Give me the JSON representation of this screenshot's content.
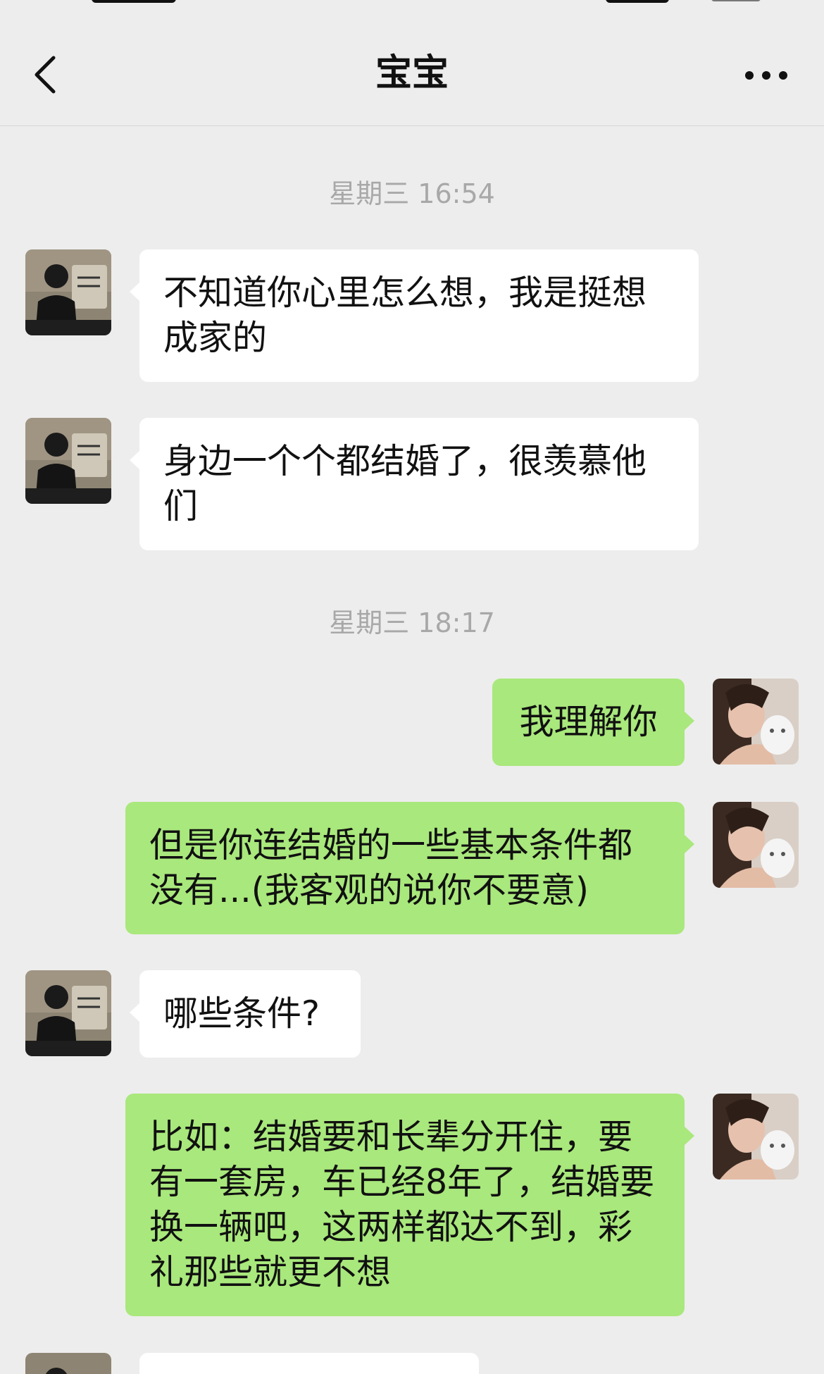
{
  "nav": {
    "title": "宝宝",
    "back_icon": "chevron-left-icon",
    "more_icon": "ellipsis-icon"
  },
  "colors": {
    "background": "#ededed",
    "incoming_bubble": "#ffffff",
    "outgoing_bubble": "#a9e87c",
    "timestamp_text": "#a8a8a8"
  },
  "messages": [
    {
      "type": "timestamp",
      "text": "星期三 16:54"
    },
    {
      "type": "message",
      "from": "other",
      "text": "不知道你心里怎么想，我是挺想成家的"
    },
    {
      "type": "message",
      "from": "other",
      "text": "身边一个个都结婚了，很羡慕他们"
    },
    {
      "type": "timestamp",
      "text": "星期三 18:17"
    },
    {
      "type": "message",
      "from": "me",
      "text": "我理解你"
    },
    {
      "type": "message",
      "from": "me",
      "text": "但是你连结婚的一些基本条件都没有...(我客观的说你不要意)"
    },
    {
      "type": "message",
      "from": "other",
      "text": "哪些条件?"
    },
    {
      "type": "message",
      "from": "me",
      "text": "比如：结婚要和长辈分开住，要有一套房，车已经8年了，结婚要换一辆吧，这两样都达不到，彩礼那些就更不想"
    }
  ]
}
